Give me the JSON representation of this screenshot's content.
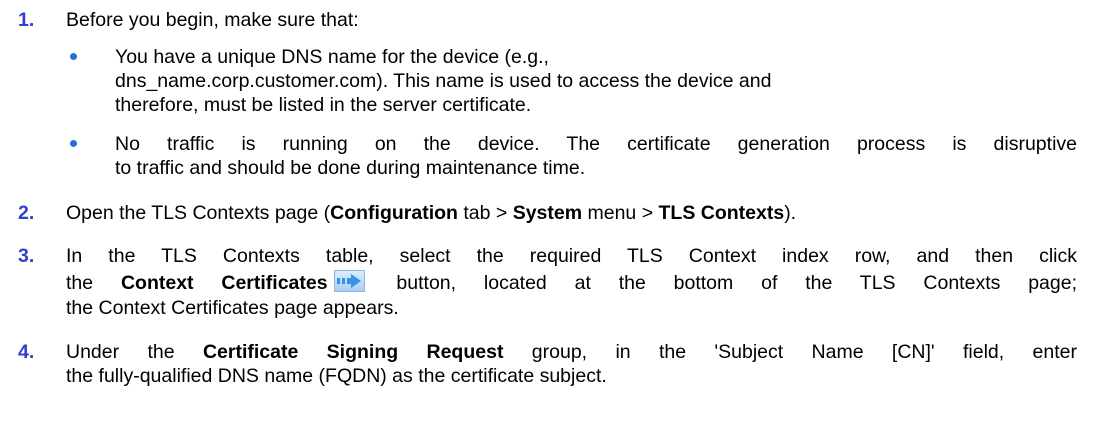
{
  "step1": {
    "number": "1.",
    "text": "Before you begin, make sure that:",
    "bullets": [
      {
        "line1": "You have a unique DNS name for the device (e.g.,",
        "line2": "dns_name.corp.customer.com). This name is used to access the device and",
        "line3": "therefore, must be listed in the server certificate."
      },
      {
        "line1": "No traffic is running on the device. The certificate generation process is disruptive",
        "line2": "to traffic and should be done during maintenance time."
      }
    ]
  },
  "step2": {
    "number": "2.",
    "t1": "Open the TLS Contexts page (",
    "b1": "Configuration",
    "t2": " tab > ",
    "b2": "System",
    "t3": " menu > ",
    "b3": "TLS Contexts",
    "t4": ")."
  },
  "step3": {
    "number": "3.",
    "line1": "In the TLS Contexts table, select the required TLS Context index row, and then click",
    "line2_pre": "the ",
    "line2_bold": "Context Certificates",
    "line2_post": " button, located at the bottom of the TLS Contexts page;",
    "line3": "the Context Certificates page appears.",
    "icon": "arrow-right-icon"
  },
  "step4": {
    "number": "4.",
    "line1_pre": "Under the ",
    "line1_bold": "Certificate Signing Request",
    "line1_post": " group, in the 'Subject Name [CN]' field, enter",
    "line2": "the fully-qualified DNS name (FQDN) as the certificate subject."
  },
  "colors": {
    "step_number": "#2f3fd0",
    "bullet": "#1e73d8",
    "icon_blue": "#3a8fe8"
  }
}
